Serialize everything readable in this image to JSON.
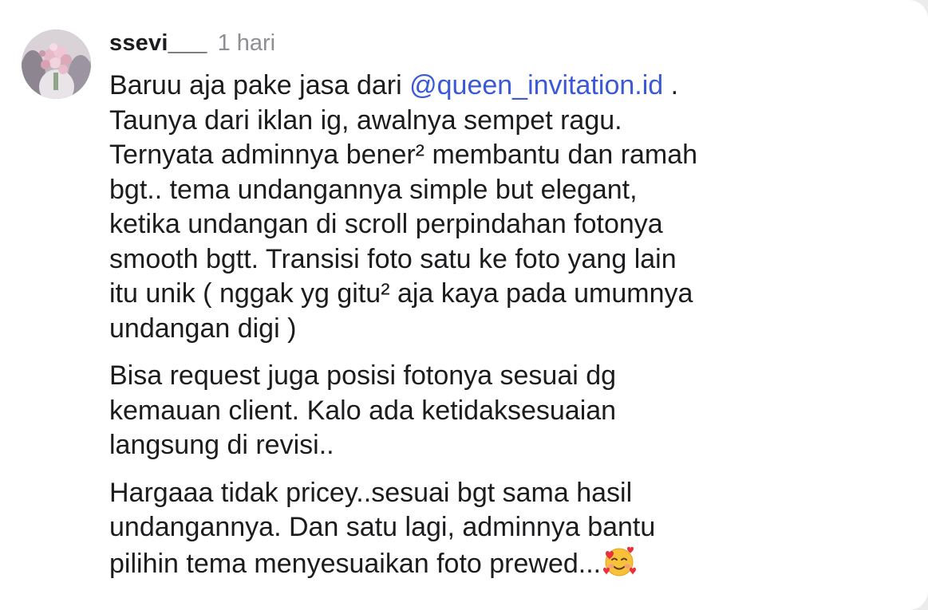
{
  "comment": {
    "username": "ssevi___",
    "timestamp": "1 hari",
    "paragraph1": {
      "line1_before": "Baruu aja pake jasa dari ",
      "mention": "@queen_invitation.id",
      "line1_after": " .",
      "lines": [
        "Taunya dari iklan ig, awalnya sempet ragu.",
        "Ternyata adminnya bener² membantu dan ramah",
        "bgt.. tema undangannya simple but elegant,",
        "ketika undangan di scroll perpindahan fotonya",
        "smooth bgtt. Transisi foto satu ke foto yang lain",
        "itu unik ( nggak yg gitu² aja kaya pada umumnya",
        "undangan digi )"
      ]
    },
    "paragraph2": {
      "lines": [
        "Bisa request juga posisi fotonya sesuai dg",
        "kemauan client. Kalo ada ketidaksesuaian",
        "langsung di revisi.."
      ]
    },
    "paragraph3": {
      "lines": [
        "Hargaaa tidak pricey..sesuai bgt sama hasil",
        "undangannya. Dan satu lagi, adminnya bantu"
      ],
      "last_line": "pilihin tema menyesuaikan foto prewed..."
    },
    "emoji": "smiling-face-with-hearts-icon",
    "colors": {
      "mention": "#3b59d6",
      "text": "#1c1c1e",
      "timestamp": "#8e8e93"
    }
  }
}
